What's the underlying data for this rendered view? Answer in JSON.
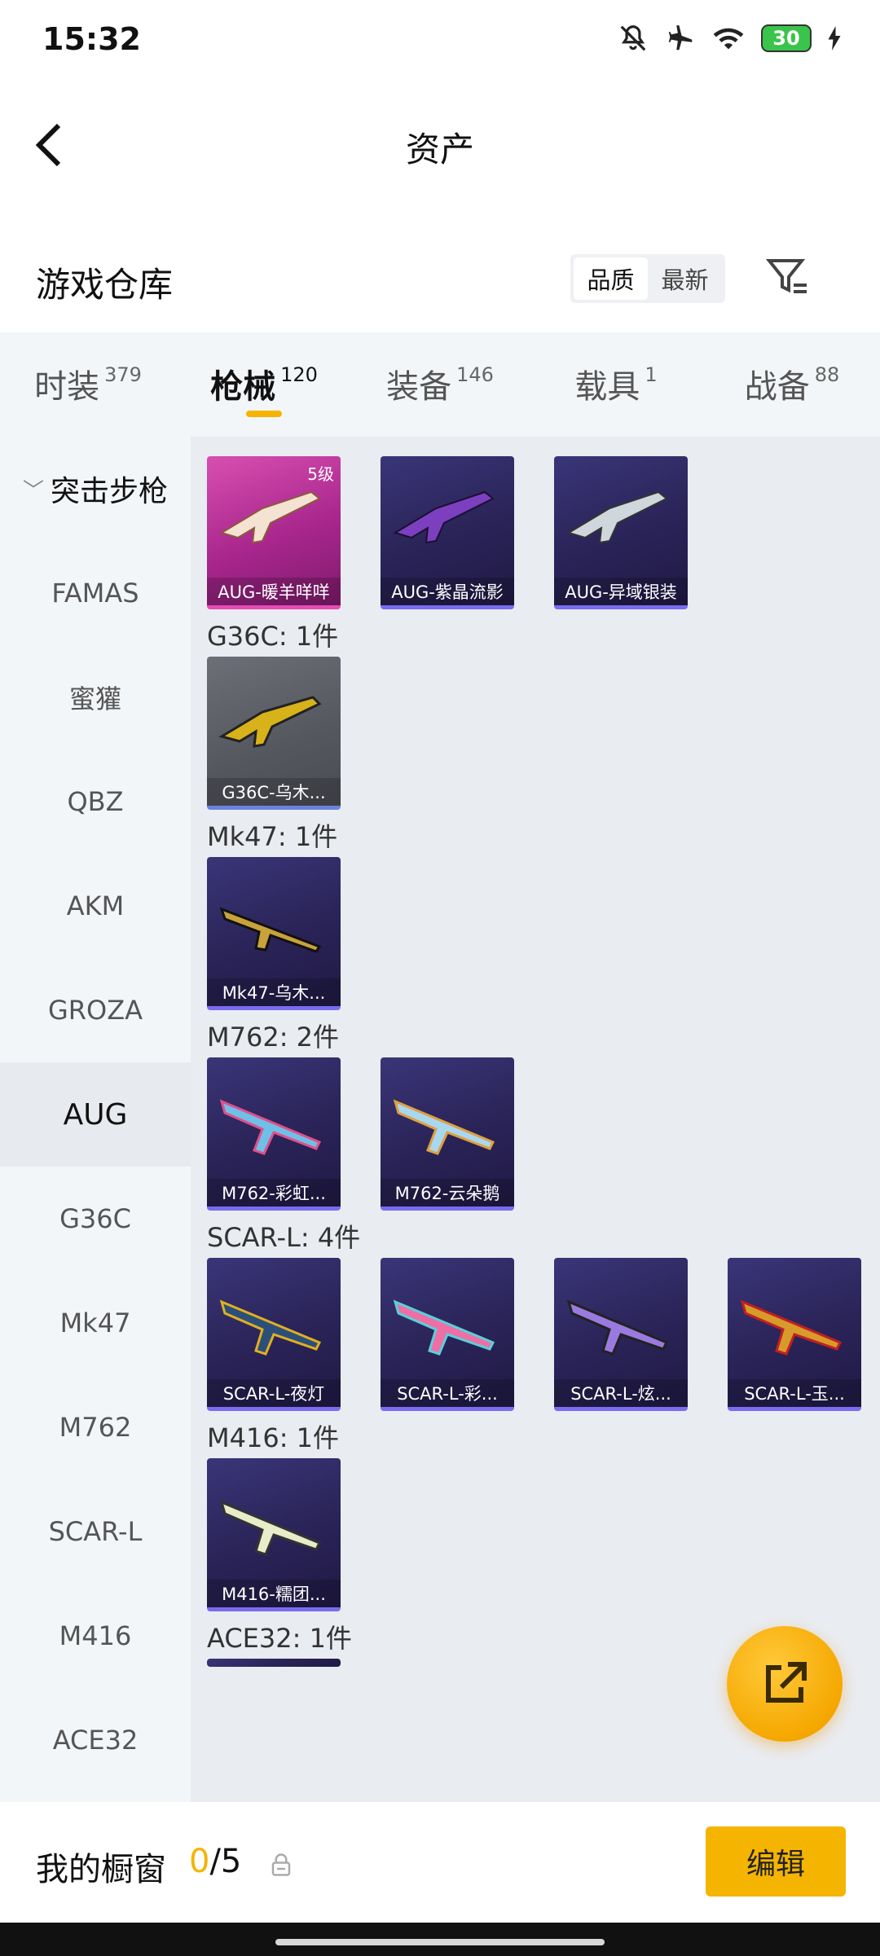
{
  "status": {
    "time": "15:32",
    "battery": "30"
  },
  "header": {
    "title": "资产"
  },
  "warehouse": {
    "title": "游戏仓库",
    "sort_options": [
      "品质",
      "最新"
    ],
    "active_sort": "品质"
  },
  "tabs": [
    {
      "label": "时装",
      "count": "379"
    },
    {
      "label": "枪械",
      "count": "120",
      "active": true
    },
    {
      "label": "装备",
      "count": "146"
    },
    {
      "label": "载具",
      "count": "1"
    },
    {
      "label": "战备",
      "count": "88"
    }
  ],
  "sidebar": {
    "category": "突击步枪",
    "items": [
      "FAMAS",
      "蜜獾",
      "QBZ",
      "AKM",
      "GROZA",
      "AUG",
      "G36C",
      "Mk47",
      "M762",
      "SCAR-L",
      "M416",
      "ACE32"
    ],
    "active": "AUG"
  },
  "groups": [
    {
      "label": "",
      "items": [
        {
          "name": "AUG-暖羊咩咩",
          "level": "5级",
          "style": "pink"
        },
        {
          "name": "AUG-紫晶流影",
          "style": "purple"
        },
        {
          "name": "AUG-异域银装",
          "style": "purple"
        }
      ]
    },
    {
      "label": "G36C: 1件",
      "items": [
        {
          "name": "G36C-乌木...",
          "style": "gray"
        }
      ]
    },
    {
      "label": "Mk47: 1件",
      "items": [
        {
          "name": "Mk47-乌木...",
          "style": "purple"
        }
      ]
    },
    {
      "label": "M762: 2件",
      "items": [
        {
          "name": "M762-彩虹...",
          "style": "purple"
        },
        {
          "name": "M762-云朵鹅",
          "style": "purple"
        }
      ]
    },
    {
      "label": "SCAR-L: 4件",
      "items": [
        {
          "name": "SCAR-L-夜灯",
          "style": "purple"
        },
        {
          "name": "SCAR-L-彩...",
          "style": "purple"
        },
        {
          "name": "SCAR-L-炫...",
          "style": "purple"
        },
        {
          "name": "SCAR-L-玉...",
          "style": "purple"
        }
      ]
    },
    {
      "label": "M416: 1件",
      "items": [
        {
          "name": "M416-糯团...",
          "style": "purple"
        }
      ]
    },
    {
      "label": "ACE32: 1件",
      "items": []
    }
  ],
  "showcase": {
    "title": "我的橱窗",
    "current": "0",
    "total": "/5",
    "edit_label": "编辑"
  },
  "colors": {
    "accent": "#f5b400",
    "card_purple": "#2a2357",
    "card_pink": "#a8268d"
  },
  "icons": [
    "back-arrow-icon",
    "filter-icon",
    "share-external-icon",
    "lock-icon",
    "mute-bell-icon",
    "airplane-icon",
    "wifi-icon",
    "charging-icon"
  ]
}
